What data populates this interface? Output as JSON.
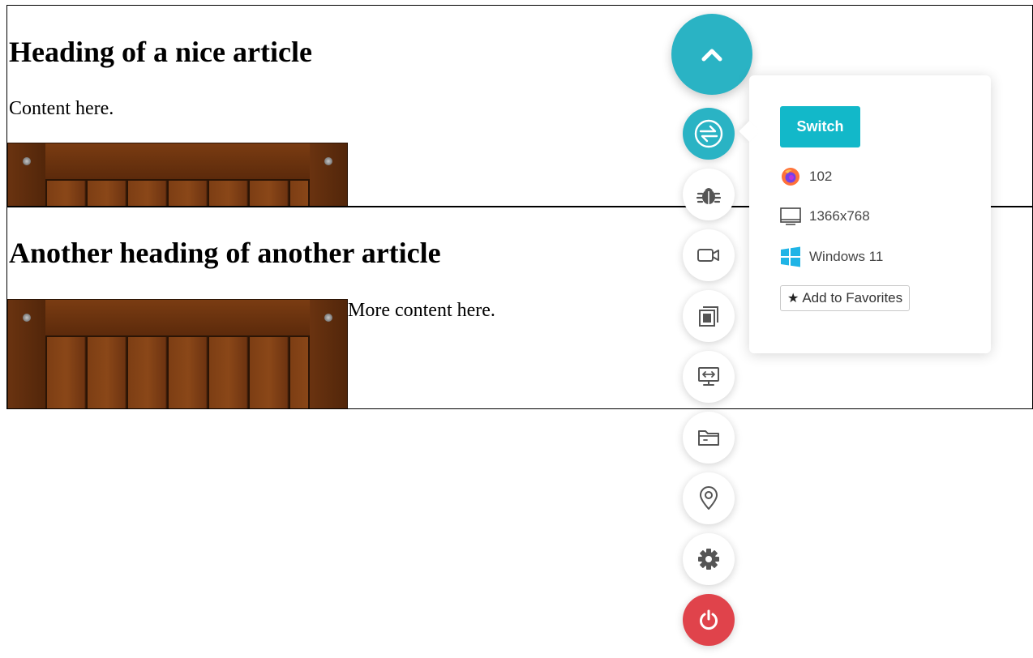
{
  "articles": [
    {
      "heading": "Heading of a nice article",
      "content": "Content here."
    },
    {
      "heading": "Another heading of another article",
      "content": "More content here."
    }
  ],
  "toolbar": {
    "main_icon": "chevron-up-icon",
    "tools": [
      {
        "name": "switch-browser",
        "icon": "switch-icon",
        "active": true
      },
      {
        "name": "bug-report",
        "icon": "bug-icon"
      },
      {
        "name": "record-video",
        "icon": "video-camera-icon"
      },
      {
        "name": "screenshot-gallery",
        "icon": "gallery-icon"
      },
      {
        "name": "screen-resolution",
        "icon": "monitor-resize-icon"
      },
      {
        "name": "files",
        "icon": "folder-icon"
      },
      {
        "name": "location",
        "icon": "location-pin-icon"
      },
      {
        "name": "settings",
        "icon": "gear-icon"
      },
      {
        "name": "stop-session",
        "icon": "power-icon"
      }
    ]
  },
  "panel": {
    "switch_label": "Switch",
    "browser_version": "102",
    "resolution": "1366x768",
    "os": "Windows 11",
    "favorites_label": "Add to Favorites"
  },
  "colors": {
    "accent": "#2ab3c4",
    "switch_button": "#12b8c9",
    "danger": "#e0434b"
  }
}
